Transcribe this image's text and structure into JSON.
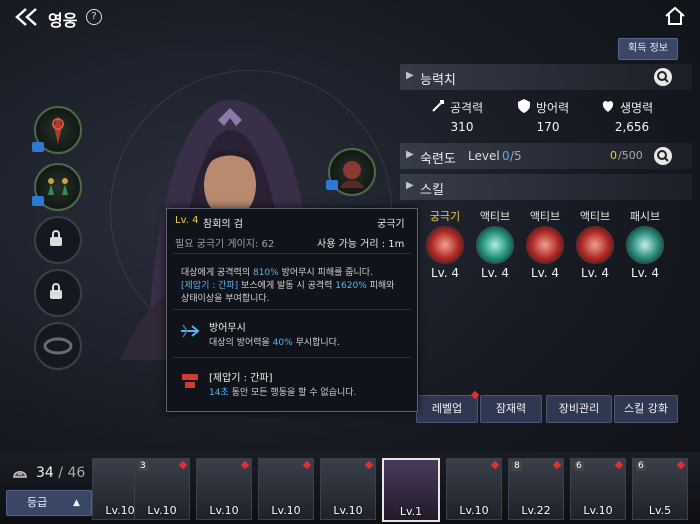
{
  "header": {
    "title": "영웅",
    "help": "?"
  },
  "panel": {
    "get_info_label": "획득 정보",
    "stats": {
      "title": "능력치",
      "items": [
        {
          "label": "공격력",
          "value": "310",
          "icon": "sword-icon"
        },
        {
          "label": "방어력",
          "value": "170",
          "icon": "shield-icon"
        },
        {
          "label": "생명력",
          "value": "2,656",
          "icon": "heart-icon"
        }
      ]
    },
    "mastery": {
      "title": "숙련도",
      "level_label": "Level",
      "level_current": "0",
      "level_max": "/5",
      "exp_current": "0",
      "exp_max": "/500"
    },
    "skills": {
      "title": "스킬",
      "items": [
        {
          "type": "궁극기",
          "lv": "Lv. 4",
          "color": "#c0302e"
        },
        {
          "type": "액티브",
          "lv": "Lv. 4",
          "color": "#2a9a8a"
        },
        {
          "type": "액티브",
          "lv": "Lv. 4",
          "color": "#c0302e"
        },
        {
          "type": "액티브",
          "lv": "Lv. 4",
          "color": "#c0302e"
        },
        {
          "type": "패시브",
          "lv": "Lv. 4",
          "color": "#2a8a7a"
        }
      ]
    },
    "actions": [
      "레벨업",
      "잠재력",
      "장비관리",
      "스킬 강화"
    ]
  },
  "tooltip": {
    "lv": "Lv. 4",
    "name": "참회의 검",
    "type": "궁극기",
    "gauge_label": "필요 궁극기 게이지: 62",
    "range_label": "사용 가능 거리 : 1m",
    "desc1_pre": "대상에게 공격력의 ",
    "desc1_hl": "810%",
    "desc1_post": " 방어무시 피해를 줍니다.",
    "desc2_hl": "[제압기 : 간파]",
    "desc2_mid": " 보스에게 발동 시 공격력 ",
    "desc2_hl2": "1620%",
    "desc2_post": " 피해와",
    "desc3": "상태이상을 부여합니다.",
    "effect1_title": "방어무시",
    "effect1_pre": "대상의 방어력을 ",
    "effect1_hl": "40%",
    "effect1_post": " 무시합니다.",
    "effect2_title": "[제압기 : 간파]",
    "effect2_hl": "14초",
    "effect2_post": " 동안 모든 행동을 할 수 없습니다."
  },
  "bottom": {
    "count_current": "34",
    "count_total": "/ 46",
    "sort_label": "등급",
    "heroes": [
      {
        "lv": "Lv.10",
        "star": "",
        "dot": true
      },
      {
        "lv": "Lv.10",
        "star": "3",
        "dot": true
      },
      {
        "lv": "Lv.10",
        "star": "",
        "dot": true
      },
      {
        "lv": "Lv.10",
        "star": "",
        "dot": true
      },
      {
        "lv": "Lv.10",
        "star": "",
        "dot": true
      },
      {
        "lv": "Lv.1",
        "star": "",
        "dot": false
      },
      {
        "lv": "Lv.10",
        "star": "",
        "dot": true
      },
      {
        "lv": "Lv.22",
        "star": "8",
        "dot": true
      },
      {
        "lv": "Lv.10",
        "star": "6",
        "dot": true
      },
      {
        "lv": "Lv.5",
        "star": "6",
        "dot": true
      }
    ]
  }
}
